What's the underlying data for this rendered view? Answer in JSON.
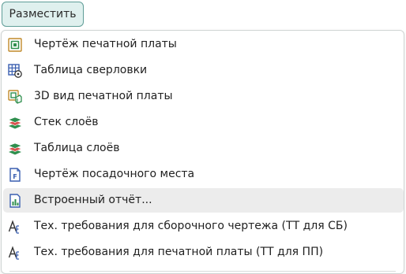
{
  "button": {
    "label": "Разместить"
  },
  "menu": {
    "items": [
      {
        "label": "Чертёж печатной платы",
        "icon": "pcb-drawing-icon"
      },
      {
        "label": "Таблица сверловки",
        "icon": "drill-table-icon"
      },
      {
        "label": "3D вид печатной платы",
        "icon": "pcb-3d-view-icon"
      },
      {
        "label": "Стек слоёв",
        "icon": "layer-stack-icon"
      },
      {
        "label": "Таблица слоёв",
        "icon": "layer-table-icon"
      },
      {
        "label": "Чертёж посадочного места",
        "icon": "footprint-drawing-icon"
      },
      {
        "label": "Встроенный отчёт...",
        "icon": "embedded-report-icon",
        "selected": true
      },
      {
        "label": "Тех. требования для сборочного чертежа (ТТ для СБ)",
        "icon": "tech-requirements-text-icon"
      },
      {
        "label": "Тех. требования для печатной платы (ТТ для ПП)",
        "icon": "tech-requirements-text-icon"
      }
    ]
  },
  "colors": {
    "button_bg": "#dff0ee",
    "button_border": "#5f9d97",
    "selected_item_bg": "#ececec",
    "icon_green": "#2f8f4e",
    "icon_blue": "#3a5fb0",
    "icon_red": "#d9534f"
  }
}
